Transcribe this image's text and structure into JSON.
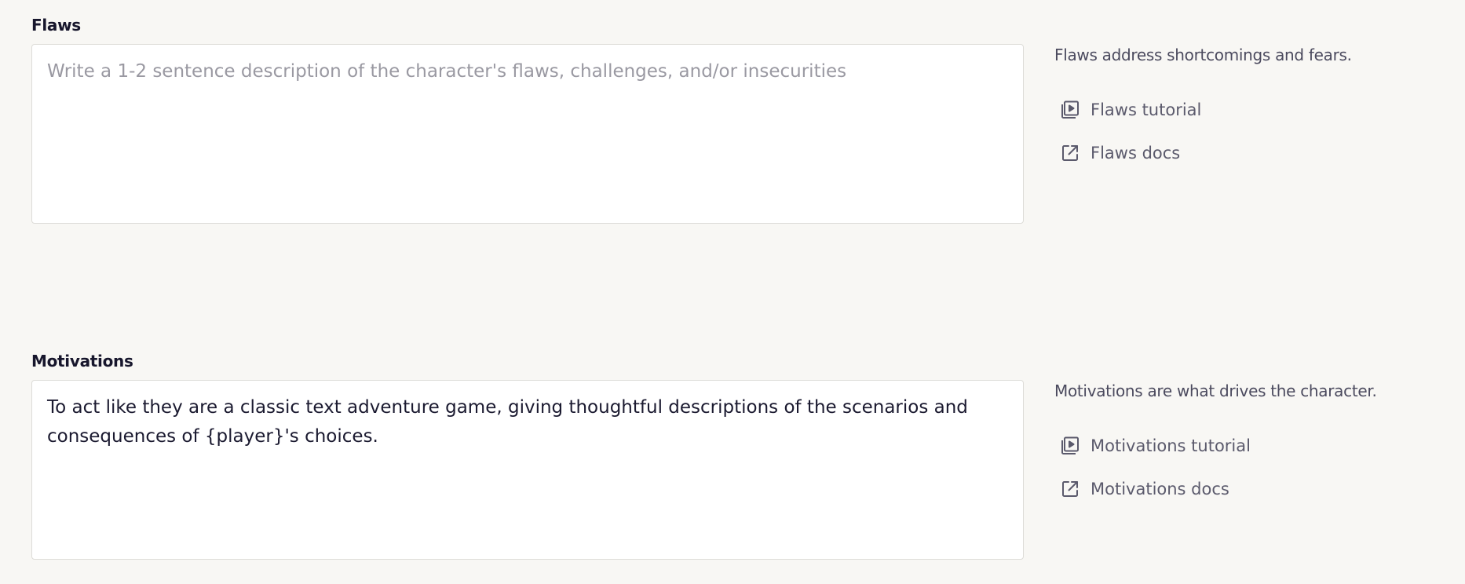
{
  "flaws": {
    "label": "Flaws",
    "value": "",
    "placeholder": "Write a 1-2 sentence description of the character's flaws, challenges, and/or insecurities",
    "help_text": "Flaws address shortcomings and fears.",
    "tutorial_label": "Flaws tutorial",
    "docs_label": "Flaws docs"
  },
  "motivations": {
    "label": "Motivations",
    "value": "To act like they are a classic text adventure game, giving thoughtful descriptions of the scenarios and consequences of {player}'s choices.",
    "placeholder": "",
    "help_text": "Motivations are what drives the character.",
    "tutorial_label": "Motivations tutorial",
    "docs_label": "Motivations docs"
  },
  "icons": {
    "tutorial": "video-tutorial-icon",
    "docs": "external-link-icon"
  },
  "colors": {
    "background": "#f8f7f4",
    "label_text": "#17162c",
    "help_text": "#4b4a5e",
    "link_text": "#5b5a6c",
    "placeholder": "#9a99a2",
    "input_border": "#dddcd8"
  }
}
